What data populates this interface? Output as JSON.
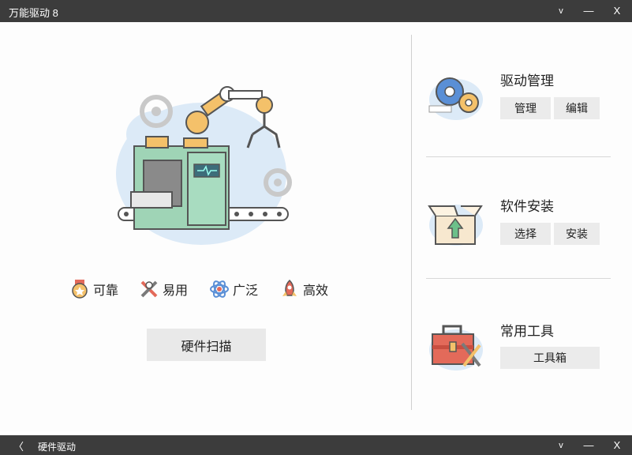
{
  "window": {
    "title": "万能驱动 8",
    "dropdown_glyph": "v",
    "minimize_glyph": "—",
    "close_glyph": "X"
  },
  "features": [
    {
      "label": "可靠",
      "icon": "medal-icon"
    },
    {
      "label": "易用",
      "icon": "tools-cross-icon"
    },
    {
      "label": "广泛",
      "icon": "atom-icon"
    },
    {
      "label": "高效",
      "icon": "rocket-icon"
    }
  ],
  "scan_button": "硬件扫描",
  "driver_management": {
    "title": "驱动管理",
    "buttons": [
      "管理",
      "编辑"
    ]
  },
  "software_install": {
    "title": "软件安装",
    "buttons": [
      "选择",
      "安装"
    ]
  },
  "common_tools": {
    "title": "常用工具",
    "buttons": [
      "工具箱"
    ]
  },
  "bottom_bar": {
    "back_glyph": "〈",
    "title": "硬件驱动",
    "dropdown_glyph": "v",
    "minimize_glyph": "—",
    "close_glyph": "X"
  },
  "colors": {
    "titlebar": "#3c3c3c",
    "button_bg": "#e9e9e9",
    "machine_green": "#9fd4b6",
    "gear_orange": "#f4c16a",
    "blob_blue": "#dceaf7"
  }
}
